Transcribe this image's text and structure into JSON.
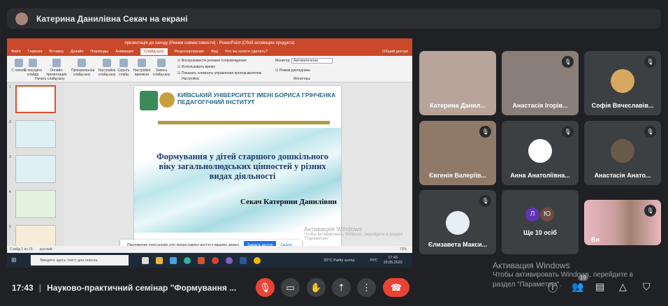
{
  "header": {
    "presenter_text": "Катерина Данилівна Секач на екрані"
  },
  "powerpoint": {
    "title": "презентація до заходу [Режим совместимости] - PowerPoint (Сбой активации продукта)",
    "tabs": [
      "Файл",
      "Главная",
      "Вставка",
      "Дизайн",
      "Переходы",
      "Анимация",
      "Слайд-шоу",
      "Рецензирование",
      "Вид",
      "Что вы хотите сделать?"
    ],
    "active_tab": "Слайд-шоу",
    "share_label": "Общий доступ",
    "ribbon": {
      "buttons": [
        "С начала",
        "С текущего слайда",
        "Онлайн-презентация",
        "Произвольное слайд-шоу",
        "Настройка слайд-шоу",
        "Скрыть слайд",
        "Настройка времени",
        "Запись слайд-шоу"
      ],
      "checkboxes": [
        "Воспроизвести речевое сопровождение",
        "Использовать время",
        "Показать элементы управления проигрывателем"
      ],
      "monitor_label": "Монитор:",
      "monitor_value": "Автоматически",
      "presenter_view": "Режим докладчика",
      "groups": [
        "Начать слайд-шоу",
        "Настройка",
        "Мониторы"
      ]
    },
    "thumb_numbers": [
      "1",
      "2",
      "3",
      "4",
      "5"
    ],
    "slide": {
      "university": "КИЇВСЬКИЙ УНІВЕРСИТЕТ ІМЕНІ БОРИСА ГРІНЧЕНКА",
      "institute": "ПЕДАГОГІЧНИЙ ІНСТИТУТ",
      "title": "Формування у дітей старшого дошкільного віку загальнолюдських цінностей у різних видах діяльності",
      "author": "Секач Катерини Данилівни"
    },
    "activation": {
      "title": "Активация Windows",
      "text": "Чтобы активировать Windows, перейдите в раздел \"Параметры\"."
    },
    "notification": {
      "text": "Приложение meet.google.com предоставлен доступ к вашему экрану.",
      "stop": "Закрыть доступ",
      "hide": "Скрыть"
    },
    "status": {
      "slide": "Слайд 1 из 16",
      "lang": "русский",
      "zoom": "73%"
    },
    "taskbar": {
      "search": "Введите здесь текст для поиска",
      "weather": "20°C Partly sunny",
      "lang": "РУС",
      "time": "17:43",
      "date": "19.05.2022"
    }
  },
  "participants": [
    {
      "name": "Катерина Данил...",
      "muted": false
    },
    {
      "name": "Анастасія Ігорів...",
      "muted": true
    },
    {
      "name": "Софія Вячеславів...",
      "muted": true
    },
    {
      "name": "Євгенія Валеріїв...",
      "muted": true
    },
    {
      "name": "Анна Анатоліївна...",
      "muted": true
    },
    {
      "name": "Анастасія Анато...",
      "muted": true
    },
    {
      "name": "Єлизавета Макси...",
      "muted": true
    },
    {
      "name": "Ще 10 осіб",
      "initials": [
        "Л",
        "Ю"
      ]
    },
    {
      "name": "Ви",
      "muted": true
    }
  ],
  "footer": {
    "time": "17:43",
    "meeting_title": "Науково-практичний семінар \"Формування ...",
    "people_count": "19"
  },
  "watermark": {
    "title": "Активация Windows",
    "text1": "Чтобы активировать Windows, перейдите в",
    "text2": "раздел \"Параметры\"."
  },
  "colors": {
    "accent_red": "#ea4335",
    "ppt_orange": "#c9492a"
  }
}
